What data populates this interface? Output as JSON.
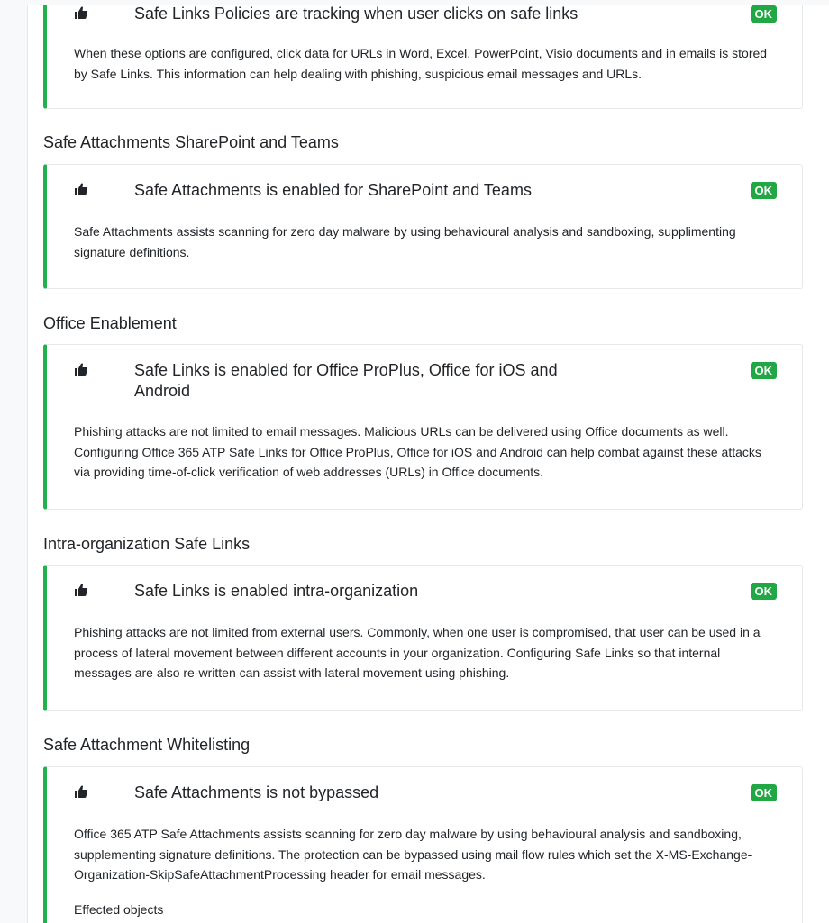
{
  "sections": [
    {
      "title": "",
      "check": {
        "title": "Safe Links Policies are tracking when user clicks on safe links",
        "status": "OK",
        "description": "When these options are configured, click data for URLs in Word, Excel, PowerPoint, Visio documents and in emails is stored by Safe Links. This information can help dealing with phishing, suspicious email messages and URLs."
      }
    },
    {
      "title": "Safe Attachments SharePoint and Teams",
      "check": {
        "title": "Safe Attachments is enabled for SharePoint and Teams",
        "status": "OK",
        "description": "Safe Attachments assists scanning for zero day malware by using behavioural analysis and sandboxing, supplimenting signature definitions."
      }
    },
    {
      "title": "Office Enablement",
      "check": {
        "title": "Safe Links is enabled for Office ProPlus, Office for iOS and Android",
        "status": "OK",
        "description": "Phishing attacks are not limited to email messages. Malicious URLs can be delivered using Office documents as well. Configuring Office 365 ATP Safe Links for Office ProPlus, Office for iOS and Android can help combat against these attacks via providing time-of-click verification of web addresses (URLs) in Office documents."
      }
    },
    {
      "title": "Intra-organization Safe Links",
      "check": {
        "title": "Safe Links is enabled intra-organization",
        "status": "OK",
        "description": "Phishing attacks are not limited from external users. Commonly, when one user is compromised, that user can be used in a process of lateral movement between different accounts in your organization. Configuring Safe Links so that internal messages are also re-written can assist with lateral movement using phishing."
      }
    },
    {
      "title": "Safe Attachment Whitelisting",
      "check": {
        "title": "Safe Attachments is not bypassed",
        "status": "OK",
        "description": "Office 365 ATP Safe Attachments assists scanning for zero day malware by using behavioural analysis and sandboxing, supplementing signature definitions. The protection can be bypassed using mail flow rules which set the X-MS-Exchange-Organization-SkipSafeAttachmentProcessing header for email messages.",
        "effected_label": "Effected objects"
      }
    }
  ],
  "colors": {
    "accent": "#22b14c",
    "ok_badge": "#22a745"
  },
  "icons": {
    "check_icon": "thumbs-up-icon"
  }
}
